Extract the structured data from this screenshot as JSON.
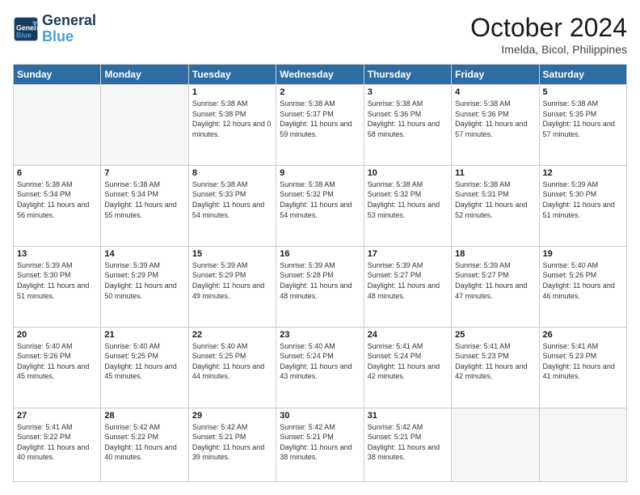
{
  "header": {
    "logo_line1": "General",
    "logo_line2": "Blue",
    "month_year": "October 2024",
    "location": "Imelda, Bicol, Philippines"
  },
  "weekdays": [
    "Sunday",
    "Monday",
    "Tuesday",
    "Wednesday",
    "Thursday",
    "Friday",
    "Saturday"
  ],
  "weeks": [
    [
      {
        "day": "",
        "empty": true
      },
      {
        "day": "",
        "empty": true
      },
      {
        "day": "1",
        "sunrise": "Sunrise: 5:38 AM",
        "sunset": "Sunset: 5:38 PM",
        "daylight": "Daylight: 12 hours and 0 minutes."
      },
      {
        "day": "2",
        "sunrise": "Sunrise: 5:38 AM",
        "sunset": "Sunset: 5:37 PM",
        "daylight": "Daylight: 11 hours and 59 minutes."
      },
      {
        "day": "3",
        "sunrise": "Sunrise: 5:38 AM",
        "sunset": "Sunset: 5:36 PM",
        "daylight": "Daylight: 11 hours and 58 minutes."
      },
      {
        "day": "4",
        "sunrise": "Sunrise: 5:38 AM",
        "sunset": "Sunset: 5:36 PM",
        "daylight": "Daylight: 11 hours and 57 minutes."
      },
      {
        "day": "5",
        "sunrise": "Sunrise: 5:38 AM",
        "sunset": "Sunset: 5:35 PM",
        "daylight": "Daylight: 11 hours and 57 minutes."
      }
    ],
    [
      {
        "day": "6",
        "sunrise": "Sunrise: 5:38 AM",
        "sunset": "Sunset: 5:34 PM",
        "daylight": "Daylight: 11 hours and 56 minutes."
      },
      {
        "day": "7",
        "sunrise": "Sunrise: 5:38 AM",
        "sunset": "Sunset: 5:34 PM",
        "daylight": "Daylight: 11 hours and 55 minutes."
      },
      {
        "day": "8",
        "sunrise": "Sunrise: 5:38 AM",
        "sunset": "Sunset: 5:33 PM",
        "daylight": "Daylight: 11 hours and 54 minutes."
      },
      {
        "day": "9",
        "sunrise": "Sunrise: 5:38 AM",
        "sunset": "Sunset: 5:32 PM",
        "daylight": "Daylight: 11 hours and 54 minutes."
      },
      {
        "day": "10",
        "sunrise": "Sunrise: 5:38 AM",
        "sunset": "Sunset: 5:32 PM",
        "daylight": "Daylight: 11 hours and 53 minutes."
      },
      {
        "day": "11",
        "sunrise": "Sunrise: 5:38 AM",
        "sunset": "Sunset: 5:31 PM",
        "daylight": "Daylight: 11 hours and 52 minutes."
      },
      {
        "day": "12",
        "sunrise": "Sunrise: 5:39 AM",
        "sunset": "Sunset: 5:30 PM",
        "daylight": "Daylight: 11 hours and 51 minutes."
      }
    ],
    [
      {
        "day": "13",
        "sunrise": "Sunrise: 5:39 AM",
        "sunset": "Sunset: 5:30 PM",
        "daylight": "Daylight: 11 hours and 51 minutes."
      },
      {
        "day": "14",
        "sunrise": "Sunrise: 5:39 AM",
        "sunset": "Sunset: 5:29 PM",
        "daylight": "Daylight: 11 hours and 50 minutes."
      },
      {
        "day": "15",
        "sunrise": "Sunrise: 5:39 AM",
        "sunset": "Sunset: 5:29 PM",
        "daylight": "Daylight: 11 hours and 49 minutes."
      },
      {
        "day": "16",
        "sunrise": "Sunrise: 5:39 AM",
        "sunset": "Sunset: 5:28 PM",
        "daylight": "Daylight: 11 hours and 48 minutes."
      },
      {
        "day": "17",
        "sunrise": "Sunrise: 5:39 AM",
        "sunset": "Sunset: 5:27 PM",
        "daylight": "Daylight: 11 hours and 48 minutes."
      },
      {
        "day": "18",
        "sunrise": "Sunrise: 5:39 AM",
        "sunset": "Sunset: 5:27 PM",
        "daylight": "Daylight: 11 hours and 47 minutes."
      },
      {
        "day": "19",
        "sunrise": "Sunrise: 5:40 AM",
        "sunset": "Sunset: 5:26 PM",
        "daylight": "Daylight: 11 hours and 46 minutes."
      }
    ],
    [
      {
        "day": "20",
        "sunrise": "Sunrise: 5:40 AM",
        "sunset": "Sunset: 5:26 PM",
        "daylight": "Daylight: 11 hours and 45 minutes."
      },
      {
        "day": "21",
        "sunrise": "Sunrise: 5:40 AM",
        "sunset": "Sunset: 5:25 PM",
        "daylight": "Daylight: 11 hours and 45 minutes."
      },
      {
        "day": "22",
        "sunrise": "Sunrise: 5:40 AM",
        "sunset": "Sunset: 5:25 PM",
        "daylight": "Daylight: 11 hours and 44 minutes."
      },
      {
        "day": "23",
        "sunrise": "Sunrise: 5:40 AM",
        "sunset": "Sunset: 5:24 PM",
        "daylight": "Daylight: 11 hours and 43 minutes."
      },
      {
        "day": "24",
        "sunrise": "Sunrise: 5:41 AM",
        "sunset": "Sunset: 5:24 PM",
        "daylight": "Daylight: 11 hours and 42 minutes."
      },
      {
        "day": "25",
        "sunrise": "Sunrise: 5:41 AM",
        "sunset": "Sunset: 5:23 PM",
        "daylight": "Daylight: 11 hours and 42 minutes."
      },
      {
        "day": "26",
        "sunrise": "Sunrise: 5:41 AM",
        "sunset": "Sunset: 5:23 PM",
        "daylight": "Daylight: 11 hours and 41 minutes."
      }
    ],
    [
      {
        "day": "27",
        "sunrise": "Sunrise: 5:41 AM",
        "sunset": "Sunset: 5:22 PM",
        "daylight": "Daylight: 11 hours and 40 minutes."
      },
      {
        "day": "28",
        "sunrise": "Sunrise: 5:42 AM",
        "sunset": "Sunset: 5:22 PM",
        "daylight": "Daylight: 11 hours and 40 minutes."
      },
      {
        "day": "29",
        "sunrise": "Sunrise: 5:42 AM",
        "sunset": "Sunset: 5:21 PM",
        "daylight": "Daylight: 11 hours and 39 minutes."
      },
      {
        "day": "30",
        "sunrise": "Sunrise: 5:42 AM",
        "sunset": "Sunset: 5:21 PM",
        "daylight": "Daylight: 11 hours and 38 minutes."
      },
      {
        "day": "31",
        "sunrise": "Sunrise: 5:42 AM",
        "sunset": "Sunset: 5:21 PM",
        "daylight": "Daylight: 11 hours and 38 minutes."
      },
      {
        "day": "",
        "empty": true
      },
      {
        "day": "",
        "empty": true
      }
    ]
  ]
}
